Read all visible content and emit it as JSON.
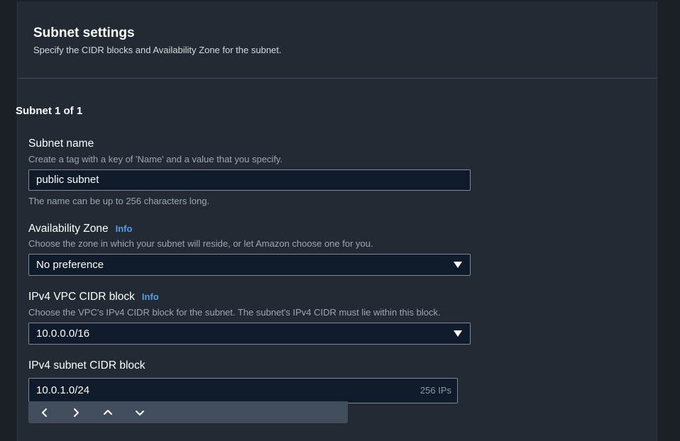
{
  "header": {
    "title": "Subnet settings",
    "subtitle": "Specify the CIDR blocks and Availability Zone for the subnet."
  },
  "subnet": {
    "count_label": "Subnet 1 of 1",
    "name": {
      "label": "Subnet name",
      "description": "Create a tag with a key of 'Name' and a value that you specify.",
      "value": "public subnet",
      "constraint": "The name can be up to 256 characters long."
    },
    "availability_zone": {
      "label": "Availability Zone",
      "info": "Info",
      "description": "Choose the zone in which your subnet will reside, or let Amazon choose one for you.",
      "selected": "No preference"
    },
    "vpc_cidr": {
      "label": "IPv4 VPC CIDR block",
      "info": "Info",
      "description": "Choose the VPC's IPv4 CIDR block for the subnet. The subnet's IPv4 CIDR must lie within this block.",
      "selected": "10.0.0.0/16"
    },
    "subnet_cidr": {
      "label": "IPv4 subnet CIDR block",
      "value": "10.0.1.0/24",
      "ip_count": "256 IPs"
    }
  },
  "toolbar": {
    "icons": [
      "chevron-left-icon",
      "chevron-right-icon",
      "chevron-up-icon",
      "chevron-down-icon"
    ]
  },
  "colors": {
    "background": "#1b1f26",
    "panel": "#232a33",
    "input_bg": "#0f1b2a",
    "info_link": "#539fe5"
  }
}
